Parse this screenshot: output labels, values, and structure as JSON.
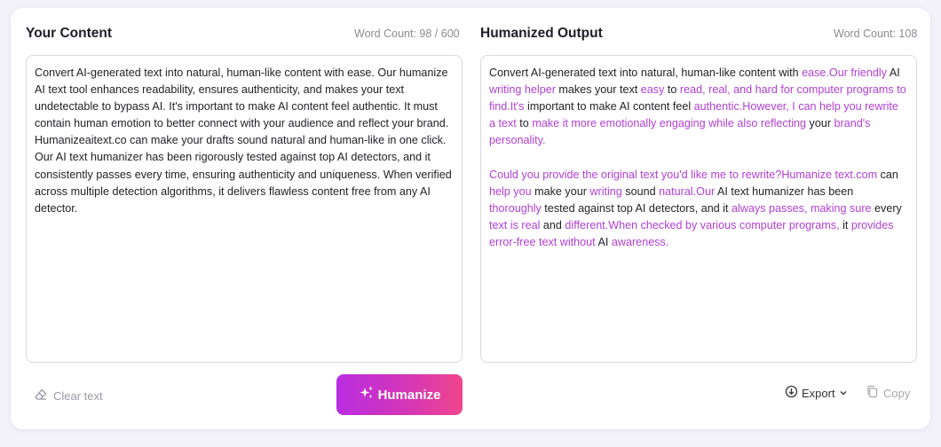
{
  "input_panel": {
    "title": "Your Content",
    "word_count": "Word Count: 98 / 600",
    "text": "Convert AI-generated text into natural, human-like content with ease. Our humanize AI text tool enhances readability, ensures authenticity, and makes your text undetectable to bypass AI. It's important to make AI content feel authentic. It must contain human emotion to better connect with your audience and reflect your brand. Humanizeaitext.co can make your drafts sound natural and human-like in one click. Our AI text humanizer has been rigorously tested against top AI detectors, and it consistently passes every time, ensuring authenticity and uniqueness. When verified across multiple detection algorithms, it delivers flawless content free from any AI detector.",
    "clear_label": "Clear text",
    "humanize_label": "Humanize"
  },
  "output_panel": {
    "title": "Humanized Output",
    "word_count": "Word Count: 108",
    "highlight_color": "#b23fd6",
    "paragraphs": [
      [
        {
          "t": "Convert AI-generated text into natural, human-like content with ",
          "h": false
        },
        {
          "t": "ease.Our friendly",
          "h": true
        },
        {
          "t": " AI ",
          "h": false
        },
        {
          "t": "writing helper",
          "h": true
        },
        {
          "t": " makes your text ",
          "h": false
        },
        {
          "t": "easy",
          "h": true
        },
        {
          "t": " to ",
          "h": false
        },
        {
          "t": "read, real, and hard for computer programs to find.It's",
          "h": true
        },
        {
          "t": " important to make AI content feel ",
          "h": false
        },
        {
          "t": "authentic.However, I can help you rewrite a text",
          "h": true
        },
        {
          "t": " to ",
          "h": false
        },
        {
          "t": "make it more emotionally engaging while also reflecting",
          "h": true
        },
        {
          "t": " your ",
          "h": false
        },
        {
          "t": "brand's personality.",
          "h": true
        }
      ],
      [
        {
          "t": "Could you provide the original text you'd like me to rewrite?Humanize text.com",
          "h": true
        },
        {
          "t": " can ",
          "h": false
        },
        {
          "t": "help you",
          "h": true
        },
        {
          "t": " make your ",
          "h": false
        },
        {
          "t": "writing",
          "h": true
        },
        {
          "t": " sound ",
          "h": false
        },
        {
          "t": "natural.Our",
          "h": true
        },
        {
          "t": " AI text humanizer has been ",
          "h": false
        },
        {
          "t": "thoroughly",
          "h": true
        },
        {
          "t": " tested against top AI detectors, and it ",
          "h": false
        },
        {
          "t": "always passes, making sure",
          "h": true
        },
        {
          "t": " every ",
          "h": false
        },
        {
          "t": "text is real",
          "h": true
        },
        {
          "t": " and ",
          "h": false
        },
        {
          "t": "different.When checked by various computer programs,",
          "h": true
        },
        {
          "t": " it ",
          "h": false
        },
        {
          "t": "provides error-free text without",
          "h": true
        },
        {
          "t": " AI ",
          "h": false
        },
        {
          "t": "awareness.",
          "h": true
        }
      ]
    ],
    "export_label": "Export",
    "copy_label": "Copy"
  },
  "icons": {
    "clear": "eraser-icon",
    "humanize": "sparkles-icon",
    "export": "download-icon",
    "export_caret": "chevron-down-icon",
    "copy": "copy-icon"
  }
}
